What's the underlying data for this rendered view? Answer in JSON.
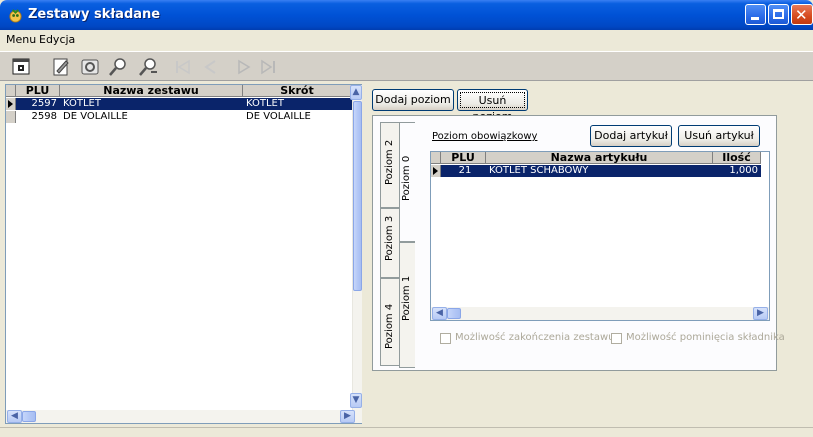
{
  "window": {
    "title": "Zestawy składane"
  },
  "menu": {
    "items": [
      "Menu",
      "Edycja"
    ]
  },
  "toolbar": {
    "icons": [
      "new-icon",
      "edit-icon",
      "recycle-icon",
      "search-icon",
      "search-next-icon",
      "first-record-icon",
      "prev-record-icon",
      "next-record-icon",
      "last-record-icon"
    ]
  },
  "left_grid": {
    "columns": [
      "PLU",
      "Nazwa zestawu",
      "Skrót"
    ],
    "rows": [
      {
        "plu": "2597",
        "name": "KOTLET",
        "short": "KOTLET",
        "selected": true
      },
      {
        "plu": "2598",
        "name": "DE VOLAILLE",
        "short": "DE VOLAILLE",
        "selected": false
      }
    ]
  },
  "level_buttons": {
    "add": "Dodaj poziom",
    "remove": "Usuń poziom"
  },
  "outer_tabs": [
    "Poziom 2",
    "Poziom 3",
    "Poziom 4"
  ],
  "inner_tabs": [
    "Poziom 0",
    "Poziom 1"
  ],
  "level_panel": {
    "title": "Poziom obowiązkowy",
    "add_article": "Dodaj artykuł",
    "remove_article": "Usuń artykuł"
  },
  "article_grid": {
    "columns": [
      "PLU",
      "Nazwa artykułu",
      "Ilość"
    ],
    "rows": [
      {
        "plu": "21",
        "name": "KOTLET SCHABOWY",
        "qty": "1,000",
        "selected": true
      }
    ]
  },
  "options": {
    "can_finish": "Możliwość zakończenia zestawu",
    "can_skip": "Możliwość pominięcia składnika"
  },
  "colors": {
    "selection": "#0a246a",
    "titlebar": "#0052d6"
  }
}
